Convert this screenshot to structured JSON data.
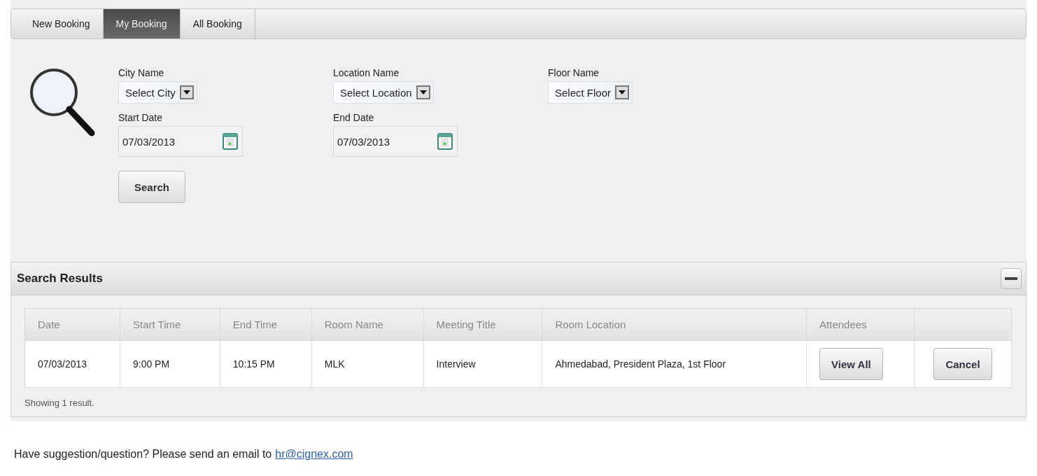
{
  "tabs": [
    {
      "label": "New Booking",
      "selected": false
    },
    {
      "label": "My Booking",
      "selected": true
    },
    {
      "label": "All Booking",
      "selected": false
    }
  ],
  "filter_rows": [
    [
      {
        "kind": "select",
        "label": "City Name",
        "value": "Select City"
      },
      {
        "kind": "select",
        "label": "Location Name",
        "value": "Select Location"
      },
      {
        "kind": "select",
        "label": "Floor Name",
        "value": "Select Floor"
      }
    ],
    [
      {
        "kind": "date",
        "label": "Start Date",
        "value": "07/03/2013"
      },
      {
        "kind": "date",
        "label": "End Date",
        "value": "07/03/2013"
      }
    ]
  ],
  "search_button": "Search",
  "results": {
    "title": "Search Results",
    "columns": [
      "Date",
      "Start Time",
      "End Time",
      "Room Name",
      "Meeting Title",
      "Room Location",
      "Attendees"
    ],
    "rows": [
      {
        "cells": [
          "07/03/2013",
          "9:00 PM",
          "10:15 PM",
          "MLK",
          "Interview",
          "Ahmedabad, President Plaza, 1st Floor"
        ],
        "attendees_button": "View All",
        "cancel_button": "Cancel"
      }
    ],
    "summary": "Showing 1 result."
  },
  "footer": {
    "text": "Have suggestion/question? Please send an email to",
    "link": "hr@cignex.com"
  }
}
